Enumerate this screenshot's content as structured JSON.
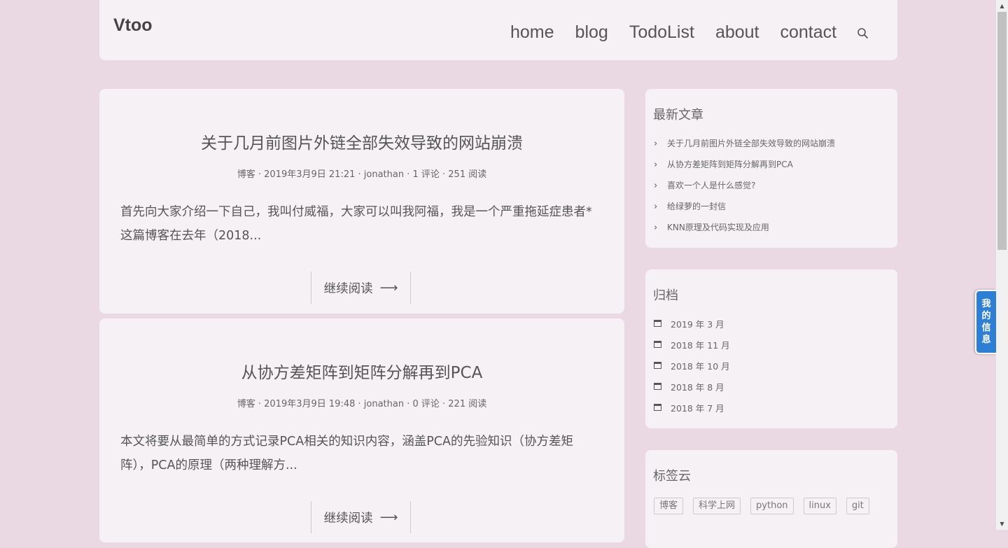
{
  "header": {
    "site_title": "Vtoo",
    "nav": [
      "home",
      "blog",
      "TodoList",
      "about",
      "contact"
    ],
    "search_icon": "search-icon"
  },
  "posts": [
    {
      "title": "关于几月前图片外链全部失效导致的网站崩溃",
      "meta": "博客 · 2019年3月9日 21:21 · jonathan · 1 评论 · 251 阅读",
      "excerpt": "首先向大家介绍一下自己，我叫付威福，大家可以叫我阿福，我是一个严重拖延症患者*这篇博客在去年（2018...",
      "read_more": "继续阅读",
      "arrow": "⟶"
    },
    {
      "title": "从协方差矩阵到矩阵分解再到PCA",
      "meta": "博客 · 2019年3月9日 19:48 · jonathan · 0 评论 · 221 阅读",
      "excerpt": "本文将要从最简单的方式记录PCA相关的知识内容，涵盖PCA的先验知识（协方差矩阵），PCA的原理（两种理解方...",
      "read_more": "继续阅读",
      "arrow": "⟶"
    }
  ],
  "sidebar": {
    "recent": {
      "title": "最新文章",
      "items": [
        "关于几月前图片外链全部失效导致的网站崩溃",
        "从协方差矩阵到矩阵分解再到PCA",
        "喜欢一个人是什么感觉?",
        "给绿萝的一封信",
        "KNN原理及代码实现及应用"
      ]
    },
    "archive": {
      "title": "归档",
      "items": [
        "2019 年 3 月",
        "2018 年 11 月",
        "2018 年 10 月",
        "2018 年 8 月",
        "2018 年 7 月"
      ]
    },
    "tags": {
      "title": "标签云",
      "items": [
        "博客",
        "科学上网",
        "python",
        "linux",
        "git"
      ]
    }
  },
  "info_tab": {
    "chars": [
      "我",
      "的",
      "信",
      "息"
    ]
  },
  "colors": {
    "background": "#ead9e3",
    "panel": "#f6f1f5",
    "info_tab": "#2d7fd6"
  }
}
